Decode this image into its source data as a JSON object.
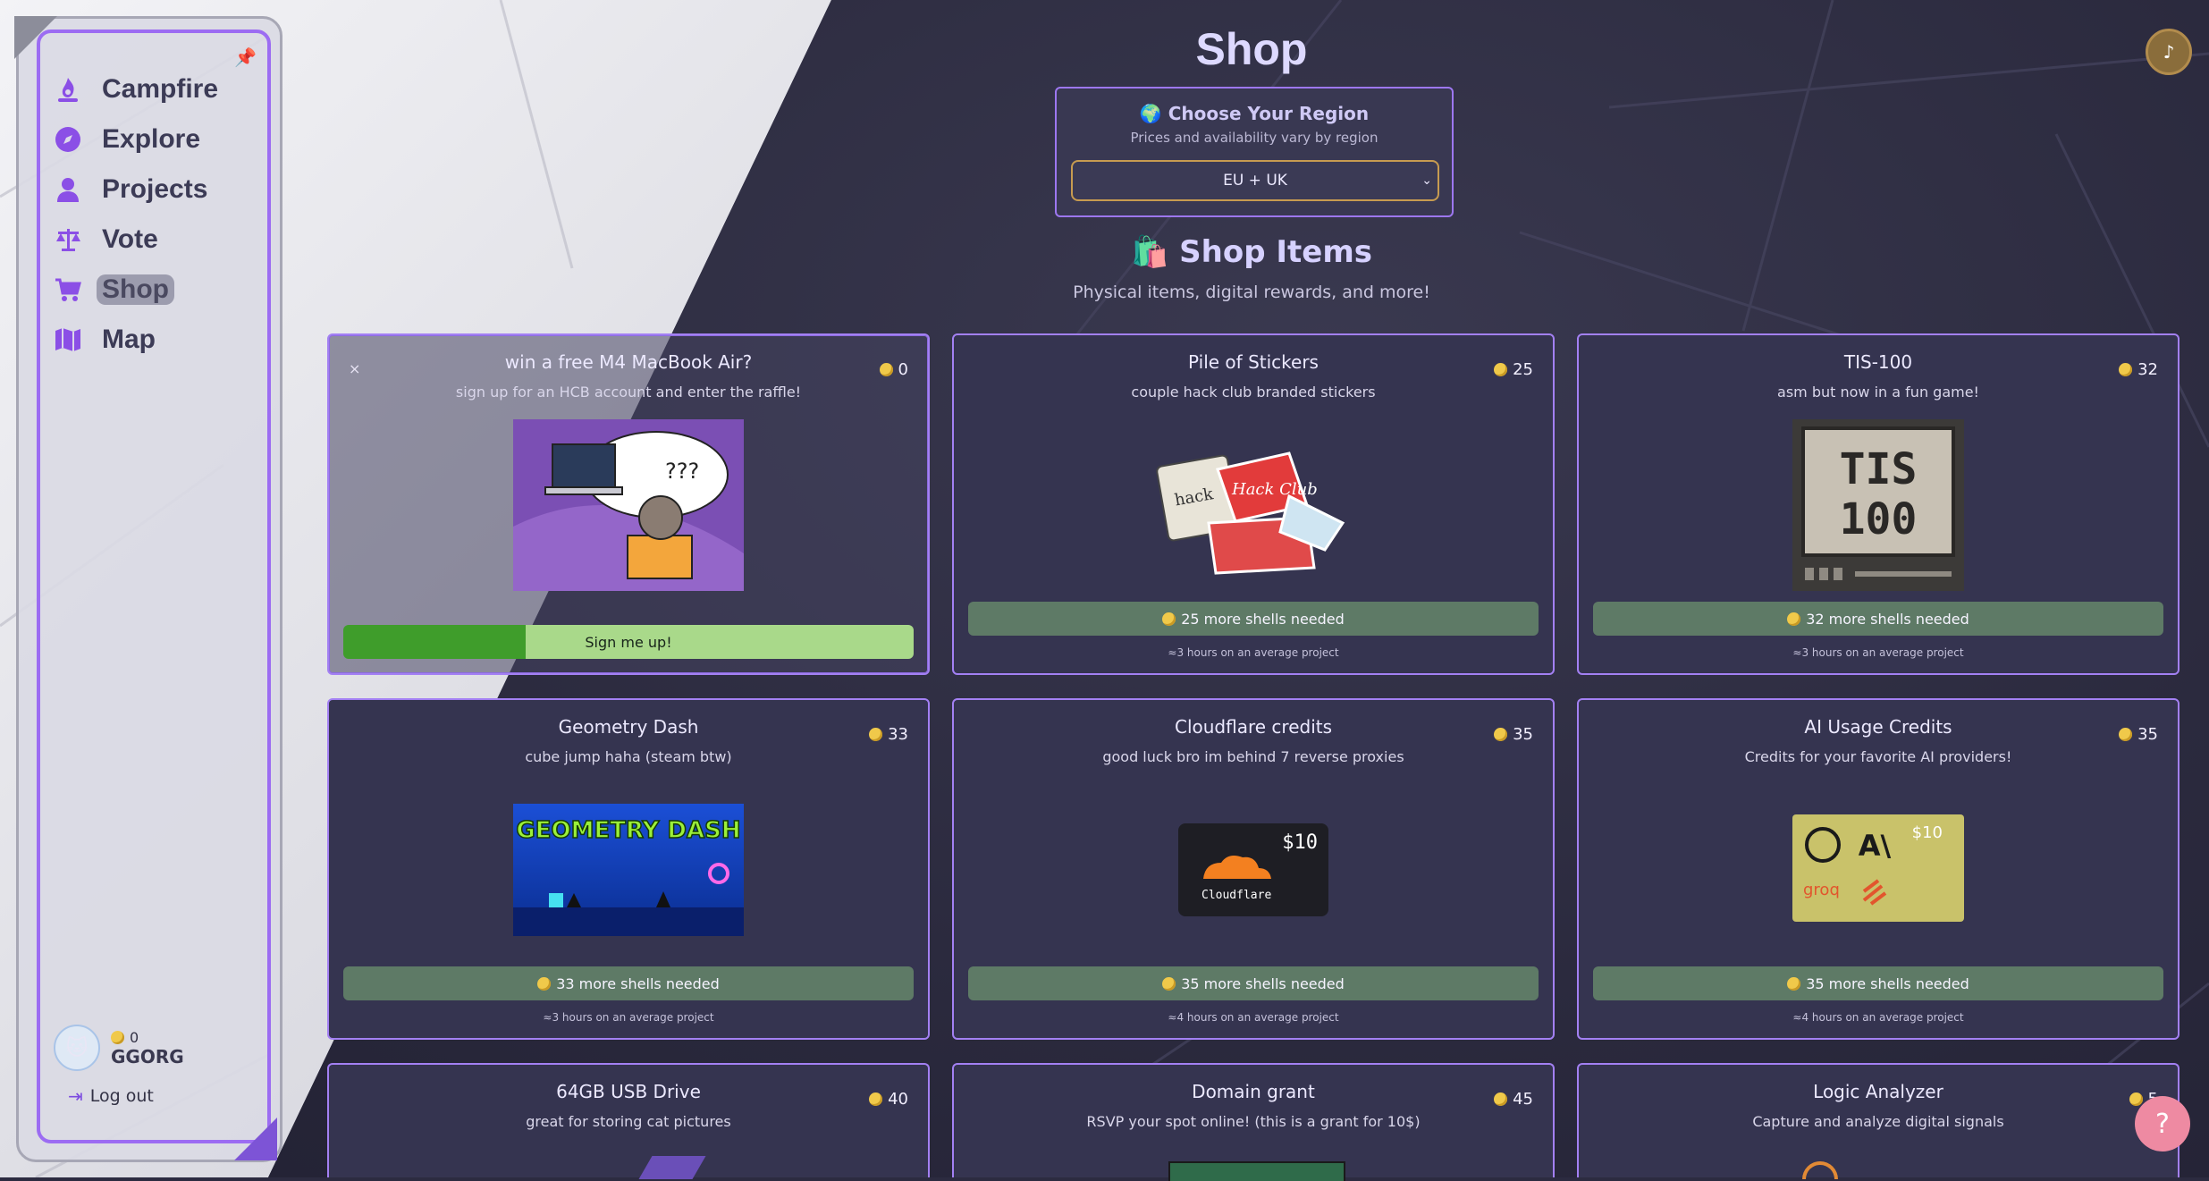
{
  "page": {
    "title": "Shop"
  },
  "sidebar": {
    "items": [
      {
        "label": "Campfire",
        "icon": "campfire-icon"
      },
      {
        "label": "Explore",
        "icon": "compass-icon"
      },
      {
        "label": "Projects",
        "icon": "user-icon"
      },
      {
        "label": "Vote",
        "icon": "scales-icon"
      },
      {
        "label": "Shop",
        "icon": "cart-icon",
        "active": true
      },
      {
        "label": "Map",
        "icon": "map-icon"
      }
    ],
    "user": {
      "shells": "0",
      "name": "GGORG"
    },
    "logout_label": "Log out"
  },
  "region": {
    "title": "🌍 Choose Your Region",
    "subtitle": "Prices and availability vary by region",
    "selected": "EU + UK"
  },
  "section": {
    "title": "🛍️ Shop Items",
    "subtitle": "Physical items, digital rewards, and more!"
  },
  "items": [
    {
      "title": "win a free M4 MacBook Air?",
      "subtitle": "sign up for an HCB account and enter the raffle!",
      "price": "0",
      "button": "Sign me up!"
    },
    {
      "title": "Pile of Stickers",
      "subtitle": "couple hack club branded stickers",
      "price": "25",
      "need": "25 more shells needed",
      "hours": "≈3 hours on an average project"
    },
    {
      "title": "TIS-100",
      "subtitle": "asm but now in a fun game!",
      "price": "32",
      "need": "32 more shells needed",
      "hours": "≈3 hours on an average project"
    },
    {
      "title": "Geometry Dash",
      "subtitle": "cube jump haha (steam btw)",
      "price": "33",
      "need": "33 more shells needed",
      "hours": "≈3 hours on an average project"
    },
    {
      "title": "Cloudflare credits",
      "subtitle": "good luck bro im behind 7 reverse proxies",
      "price": "35",
      "need": "35 more shells needed",
      "hours": "≈4 hours on an average project"
    },
    {
      "title": "AI Usage Credits",
      "subtitle": "Credits for your favorite AI providers!",
      "price": "35",
      "need": "35 more shells needed",
      "hours": "≈4 hours on an average project"
    },
    {
      "title": "64GB USB Drive",
      "subtitle": "great for storing cat pictures",
      "price": "40"
    },
    {
      "title": "Domain grant",
      "subtitle": "RSVP your spot online! (this is a grant for 10$)",
      "price": "45"
    },
    {
      "title": "Logic Analyzer",
      "subtitle": "Capture and analyze digital signals",
      "price": "5"
    }
  ],
  "images": {
    "macbook_text": "???",
    "tis_text_1": "TIS",
    "tis_text_2": "100",
    "gd_text": "GEOMETRY DASH",
    "cf_amount": "$10",
    "cf_name": "Cloudflare",
    "ai_amount": "$10",
    "ai_groq": "groq",
    "ai_anthropic": "A\\",
    "sticker_hack": "hack",
    "sticker_club": "Hack Club"
  },
  "colors": {
    "accent": "#9c6cf2",
    "need_bar": "#5e7a66",
    "coin": "#f0c94a",
    "help": "#ee8aa2"
  }
}
